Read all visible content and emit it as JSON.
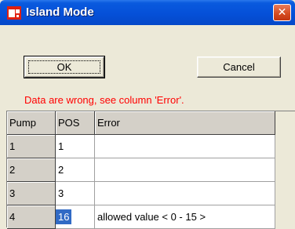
{
  "window": {
    "title": "Island Mode",
    "close_glyph": "✕"
  },
  "buttons": {
    "ok_label": "OK",
    "cancel_label": "Cancel"
  },
  "error_message": "Data are wrong, see column 'Error'.",
  "table": {
    "columns": [
      "Pump",
      "POS",
      "Error"
    ],
    "rows": [
      {
        "pump": "1",
        "pos": "1",
        "error": ""
      },
      {
        "pump": "2",
        "pos": "2",
        "error": ""
      },
      {
        "pump": "3",
        "pos": "3",
        "error": ""
      },
      {
        "pump": "4",
        "pos": "16",
        "error": "allowed value < 0 - 15 >",
        "selected": true
      }
    ]
  },
  "colors": {
    "titlebar": "#0550d8",
    "error_text": "#ff0000",
    "selection": "#316ac5"
  },
  "icons": {
    "app_icon": "island-mode-app-icon",
    "close_icon": "close-icon"
  }
}
